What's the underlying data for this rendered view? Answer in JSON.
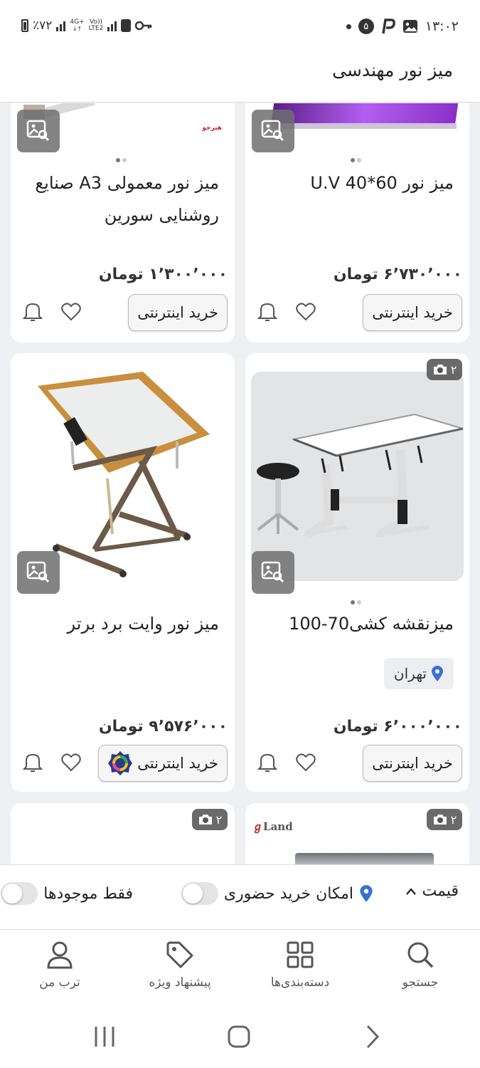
{
  "status_bar": {
    "battery": "٪۷۲",
    "network_top": "4G+",
    "network_bottom": "Vo))",
    "lte": "LTE2",
    "notif_count": "۵",
    "time": "۱۳:۰۲"
  },
  "header": {
    "title": "میز نور مهندسی"
  },
  "products": [
    {
      "title": "میز نور 60*40 U.V",
      "price": "۶٬۷۳۰٬۰۰۰ تومان",
      "buy_label": "خرید اینترنتی"
    },
    {
      "title": "میز نور معمولی A3 صنایع روشنایی سورین",
      "price": "۱٬۳۰۰٬۰۰۰ تومان",
      "buy_label": "خرید اینترنتی",
      "brand_logo_text": "هنرجو"
    },
    {
      "title": "میزنقشه کشی70-100",
      "price": "۶٬۰۰۰٬۰۰۰ تومان",
      "buy_label": "خرید اینترنتی",
      "location": "تهران",
      "photo_count": "۲"
    },
    {
      "title": "میز نور وایت برد برتر",
      "price": "۹٬۵۷۶٬۰۰۰ تومان",
      "buy_label": "خرید اینترنتی"
    },
    {
      "photo_count": "۲",
      "brand_logo_text": "Land"
    },
    {
      "photo_count": "۲"
    }
  ],
  "filters": {
    "price_label": "قیمت",
    "in_person_label": "امکان خرید حضوری",
    "in_stock_label": "فقط موجودها"
  },
  "bottom_nav": {
    "search": "جستجو",
    "categories": "دسته‌بندی‌ها",
    "offers": "پیشنهاد ویژه",
    "my_torob": "ترب من"
  },
  "colors": {
    "accent_blue": "#3b6fd8",
    "price_text": "#333333"
  }
}
